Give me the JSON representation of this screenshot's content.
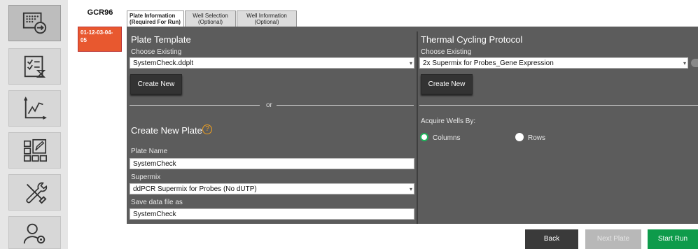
{
  "plate": {
    "name": "GCR96",
    "badge": "01-12-03-04-05"
  },
  "tabs": [
    {
      "line1": "Plate Information",
      "line2": "(Required For Run)"
    },
    {
      "line1": "Well Selection",
      "line2": "(Optional)"
    },
    {
      "line1": "Well Information",
      "line2": "(Optional)"
    }
  ],
  "left": {
    "template_title": "Plate Template",
    "choose_label": "Choose Existing",
    "choose_value": "SystemCheck.ddplt",
    "create_new": "Create New",
    "or": "or",
    "new_plate_title": "Create New Plate",
    "help": "?",
    "plate_name_label": "Plate Name",
    "plate_name_value": "SystemCheck",
    "supermix_label": "Supermix",
    "supermix_value": "ddPCR Supermix for Probes (No dUTP)",
    "save_label": "Save data file as",
    "save_value": "SystemCheck"
  },
  "right": {
    "protocol_title": "Thermal Cycling Protocol",
    "choose_label": "Choose Existing",
    "choose_value": "2x Supermix for Probes_Gene Expression",
    "create_new": "Create New",
    "acquire_label": "Acquire Wells By:",
    "opt_columns": "Columns",
    "opt_rows": "Rows"
  },
  "buttons": {
    "back": "Back",
    "next": "Next Plate",
    "start": "Start Run"
  },
  "colors": {
    "accent_orange": "#e8582f",
    "start_green": "#0e9b4b",
    "panel": "#5c5c5c"
  }
}
